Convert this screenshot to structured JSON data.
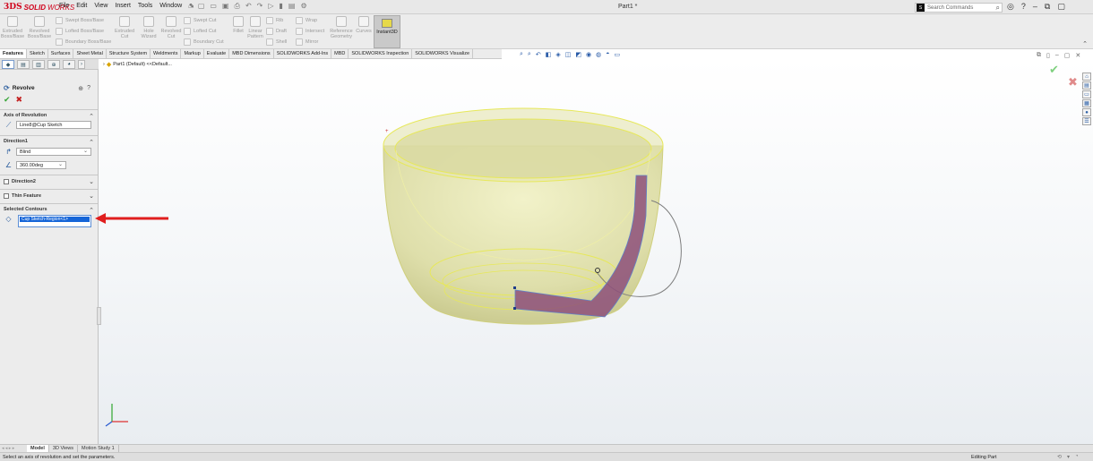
{
  "app": {
    "logo_ds": "3DS",
    "logo_bold": "SOLID",
    "logo_light": "WORKS",
    "document_title": "Part1 *"
  },
  "menu": [
    "File",
    "Edit",
    "View",
    "Insert",
    "Tools",
    "Window"
  ],
  "search": {
    "placeholder": "Search Commands"
  },
  "ribbon": {
    "buttons": [
      {
        "label": "Extruded\nBoss/Base"
      },
      {
        "label": "Revolved\nBoss/Base"
      },
      {
        "label": "Extruded\nCut"
      },
      {
        "label": "Hole\nWizard"
      },
      {
        "label": "Revolved\nCut"
      },
      {
        "label": "Fillet"
      },
      {
        "label": "Linear\nPattern"
      },
      {
        "label": "Reference\nGeometry"
      },
      {
        "label": "Curves"
      }
    ],
    "rows": {
      "swept_boss": "Swept Boss/Base",
      "lofted_boss": "Lofted Boss/Base",
      "boundary_boss": "Boundary Boss/Base",
      "swept_cut": "Swept Cut",
      "lofted_cut": "Lofted Cut",
      "boundary_cut": "Boundary Cut",
      "rib": "Rib",
      "wrap": "Wrap",
      "draft": "Draft",
      "intersect": "Intersect",
      "shell": "Shell",
      "mirror": "Mirror"
    },
    "instant3d": "Instant3D"
  },
  "tabs": [
    "Features",
    "Sketch",
    "Surfaces",
    "Sheet Metal",
    "Structure System",
    "Weldments",
    "Markup",
    "Evaluate",
    "MBD Dimensions",
    "SOLIDWORKS Add-Ins",
    "MBD",
    "SOLIDWORKS Inspection",
    "SOLIDWORKS Visualize"
  ],
  "active_tab": "Features",
  "property_manager": {
    "title": "Revolve",
    "axis_section": "Axis of Revolution",
    "axis_value": "Line8@Cup Sketch",
    "direction1_section": "Direction1",
    "end_condition": "Blind",
    "angle": "360.00deg",
    "direction2_section": "Direction2",
    "thin_feature": "Thin Feature",
    "contours_section": "Selected Contours",
    "contour_value": "Cup Sketch-Region<1>"
  },
  "feature_tree": {
    "root": "Part1 (Default) <<Default..."
  },
  "bottom_tabs": [
    "Model",
    "3D Views",
    "Motion Study 1"
  ],
  "active_bottom_tab": "Model",
  "status": {
    "message": "Select an axis of revolution and set the parameters.",
    "mode": "Editing Part"
  },
  "colors": {
    "accent_red": "#d0021b",
    "selection_blue": "#1565d8",
    "preview_yellow": "#dcdc7a",
    "profile_purple": "#8d4f7a",
    "annotation_arrow": "#e01e1e"
  }
}
